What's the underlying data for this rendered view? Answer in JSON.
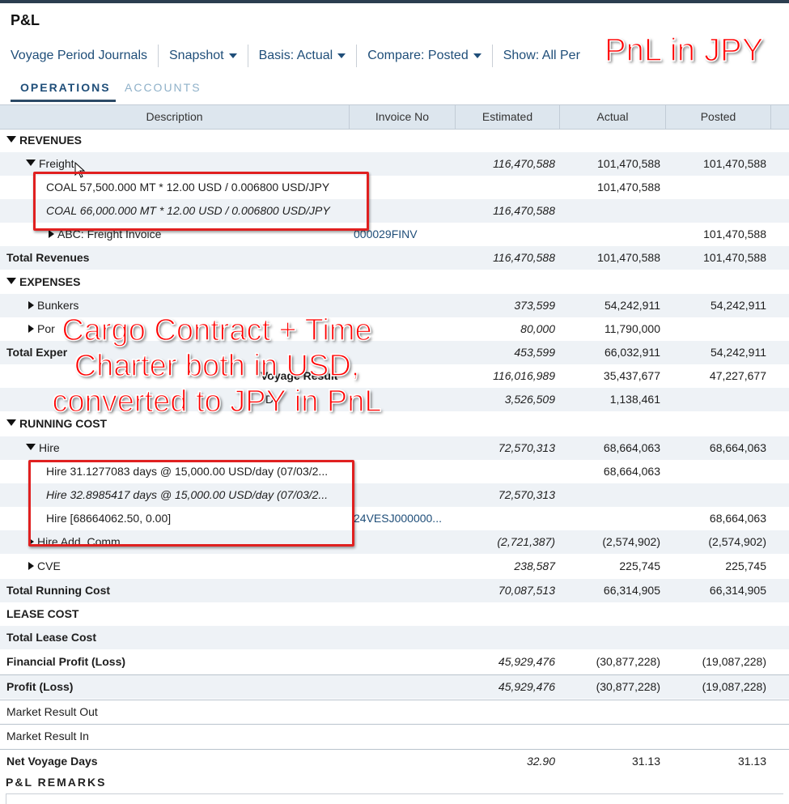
{
  "window": {
    "title": "P&L"
  },
  "toolbar": {
    "journals": "Voyage Period Journals",
    "snapshot": "Snapshot",
    "basis": "Basis: Actual",
    "compare": "Compare: Posted",
    "show": "Show: All Per"
  },
  "tabs": [
    {
      "label": "OPERATIONS"
    },
    {
      "label": "ACCOUNTS"
    }
  ],
  "columns": [
    "Description",
    "Invoice No",
    "Estimated",
    "Actual",
    "Posted"
  ],
  "rows": [
    {
      "desc": "REVENUES"
    },
    {
      "desc": "Freight",
      "est": "116,470,588",
      "act": "101,470,588",
      "pos": "101,470,588"
    },
    {
      "desc": "COAL 57,500.000 MT * 12.00 USD / 0.006800 USD/JPY",
      "act": "101,470,588"
    },
    {
      "desc": "COAL 66,000.000 MT * 12.00 USD / 0.006800 USD/JPY",
      "est": "116,470,588"
    },
    {
      "desc": "ABC: Freight Invoice",
      "inv": "000029FINV",
      "pos": "101,470,588"
    },
    {
      "desc": "Total Revenues",
      "est": "116,470,588",
      "act": "101,470,588",
      "pos": "101,470,588"
    },
    {
      "desc": "EXPENSES"
    },
    {
      "desc": "Bunkers",
      "est": "373,599",
      "act": "54,242,911",
      "pos": "54,242,911"
    },
    {
      "desc": "Por",
      "est": "80,000",
      "act": "11,790,000"
    },
    {
      "desc": "Total Exper",
      "est": "453,599",
      "act": "66,032,911",
      "pos": "54,242,911"
    },
    {
      "desc": "Voyage Result",
      "est": "116,016,989",
      "act": "35,437,677",
      "pos": "47,227,677"
    },
    {
      "desc": "D",
      "est": "3,526,509",
      "act": "1,138,461"
    },
    {
      "desc": "RUNNING COST"
    },
    {
      "desc": "Hire",
      "est": "72,570,313",
      "act": "68,664,063",
      "pos": "68,664,063"
    },
    {
      "desc": "Hire 31.1277083 days @ 15,000.00 USD/day (07/03/2...",
      "act": "68,664,063"
    },
    {
      "desc": "Hire 32.8985417 days @ 15,000.00 USD/day (07/03/2...",
      "est": "72,570,313"
    },
    {
      "desc": "Hire [68664062.50, 0.00]",
      "inv": "24VESJ000000...",
      "pos": "68,664,063"
    },
    {
      "desc": "Hire Add. Comm.",
      "est": "(2,721,387)",
      "act": "(2,574,902)",
      "pos": "(2,574,902)"
    },
    {
      "desc": "CVE",
      "est": "238,587",
      "act": "225,745",
      "pos": "225,745"
    },
    {
      "desc": "Total Running Cost",
      "est": "70,087,513",
      "act": "66,314,905",
      "pos": "66,314,905"
    },
    {
      "desc": "LEASE COST"
    },
    {
      "desc": "Total Lease Cost"
    },
    {
      "desc": "Financial Profit (Loss)",
      "est": "45,929,476",
      "act": "(30,877,228)",
      "pos": "(19,087,228)"
    },
    {
      "desc": "Profit (Loss)",
      "est": "45,929,476",
      "act": "(30,877,228)",
      "pos": "(19,087,228)"
    },
    {
      "desc": "Market Result Out"
    },
    {
      "desc": "Market Result In"
    },
    {
      "desc": "Net Voyage Days",
      "est": "32.90",
      "act": "31.13",
      "pos": "31.13"
    }
  ],
  "remarks": {
    "label": "P&L REMARKS"
  },
  "annotations": {
    "top_right": "PnL in JPY",
    "middle_line1": "Cargo Contract + Time",
    "middle_line2": "Charter both in USD,",
    "middle_line3": "converted to JPY in PnL",
    "color": "#ff0000"
  }
}
